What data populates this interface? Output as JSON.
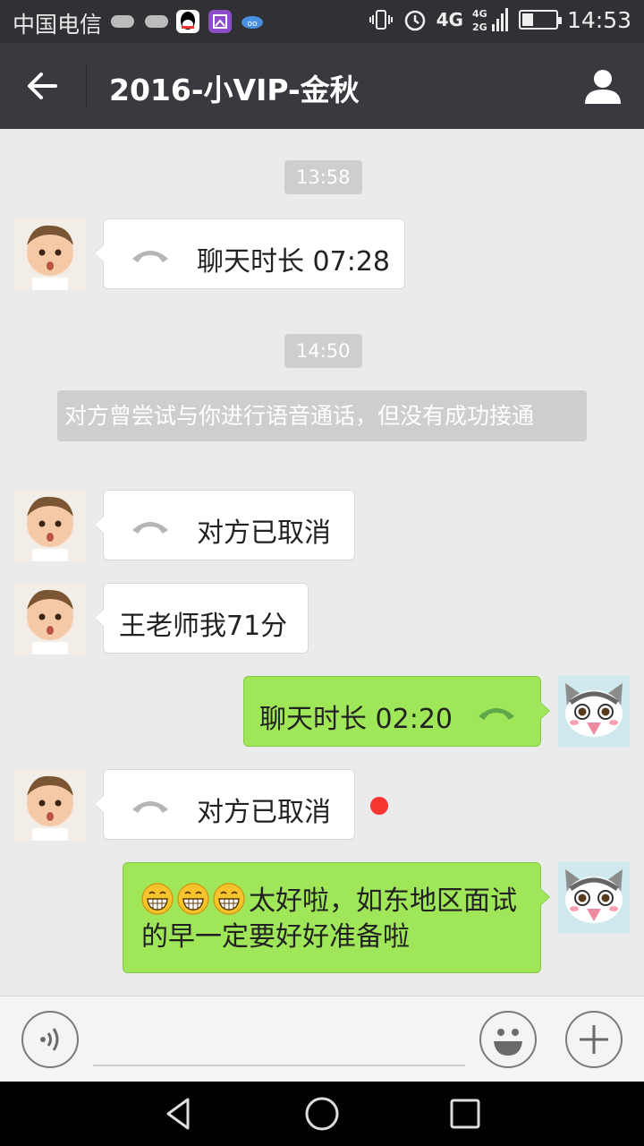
{
  "status_bar": {
    "carrier": "中国电信",
    "network": "4G",
    "network_small": "4G\n2G",
    "time": "14:53",
    "icons": [
      "qq-icon",
      "image-icon",
      "cloud-icon",
      "vibrate-icon",
      "alarm-icon",
      "signal-icon",
      "battery-icon"
    ]
  },
  "header": {
    "title": "2016-小VIP-金秋",
    "back_icon": "arrow-left-icon",
    "profile_icon": "person-icon"
  },
  "chat": {
    "time_1": "13:58",
    "time_2": "14:50",
    "system_note": "对方曾尝试与你进行语音通话，但没有成功接通",
    "messages": [
      {
        "side": "left",
        "type": "call",
        "text": "聊天时长 07:28"
      },
      {
        "side": "left",
        "type": "call",
        "text": "对方已取消"
      },
      {
        "side": "left",
        "type": "text",
        "text": "王老师我71分"
      },
      {
        "side": "right",
        "type": "call",
        "text": "聊天时长 02:20"
      },
      {
        "side": "left",
        "type": "call",
        "text": "对方已取消",
        "unread": true
      },
      {
        "side": "right",
        "type": "text",
        "emoji_count": 3,
        "text": "太好啦，如东地区面试的早一定要好好准备啦"
      }
    ]
  },
  "input_bar": {
    "placeholder": "",
    "voice_icon": "voice-icon",
    "emoji_icon": "smiley-icon",
    "more_icon": "plus-icon"
  },
  "nav": {
    "icons": [
      "back-triangle-icon",
      "home-circle-icon",
      "recents-square-icon"
    ]
  },
  "colors": {
    "title_bar": "#393a3f",
    "status_bar": "#2f3134",
    "background": "#ebebeb",
    "bubble_right": "#9fe658",
    "bubble_left": "#ffffff",
    "unread": "#f43530"
  }
}
